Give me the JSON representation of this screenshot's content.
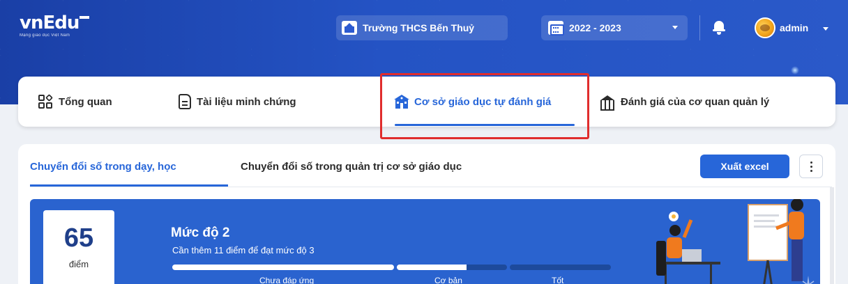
{
  "header": {
    "logo_text": "vnEdu",
    "logo_tagline": "Mạng giáo dục Việt Nam",
    "school_name": "Trường THCS Bến Thuỷ",
    "school_year": "2022 - 2023",
    "user_name": "admin"
  },
  "tabs": [
    {
      "label": "Tổng quan",
      "icon": "grid-icon"
    },
    {
      "label": "Tài liệu minh chứng",
      "icon": "document-icon"
    },
    {
      "label": "Cơ sở giáo dục tự đánh giá",
      "icon": "school-icon",
      "active": true
    },
    {
      "label": "Đánh giá của cơ quan quản lý",
      "icon": "bank-icon"
    }
  ],
  "subtabs": [
    {
      "label": "Chuyển đổi số trong dạy, học",
      "active": true
    },
    {
      "label": "Chuyển đổi số trong quản trị cơ sở giáo dục"
    }
  ],
  "toolbar": {
    "export_label": "Xuất excel"
  },
  "score": {
    "value": "65",
    "unit": "điểm",
    "level": "Mức độ 2",
    "message": "Cần thêm 11 điểm để đạt mức độ 3",
    "progress": [
      {
        "label": "Chưa đáp ứng",
        "fill": 1.0
      },
      {
        "label": "Cơ bản",
        "fill": 0.63
      },
      {
        "label": "Tốt",
        "fill": 0.0
      }
    ]
  },
  "colors": {
    "accent": "#2766d9",
    "header": "#2453c4",
    "banner": "#2a63cf",
    "highlight": "#e02d2d"
  }
}
